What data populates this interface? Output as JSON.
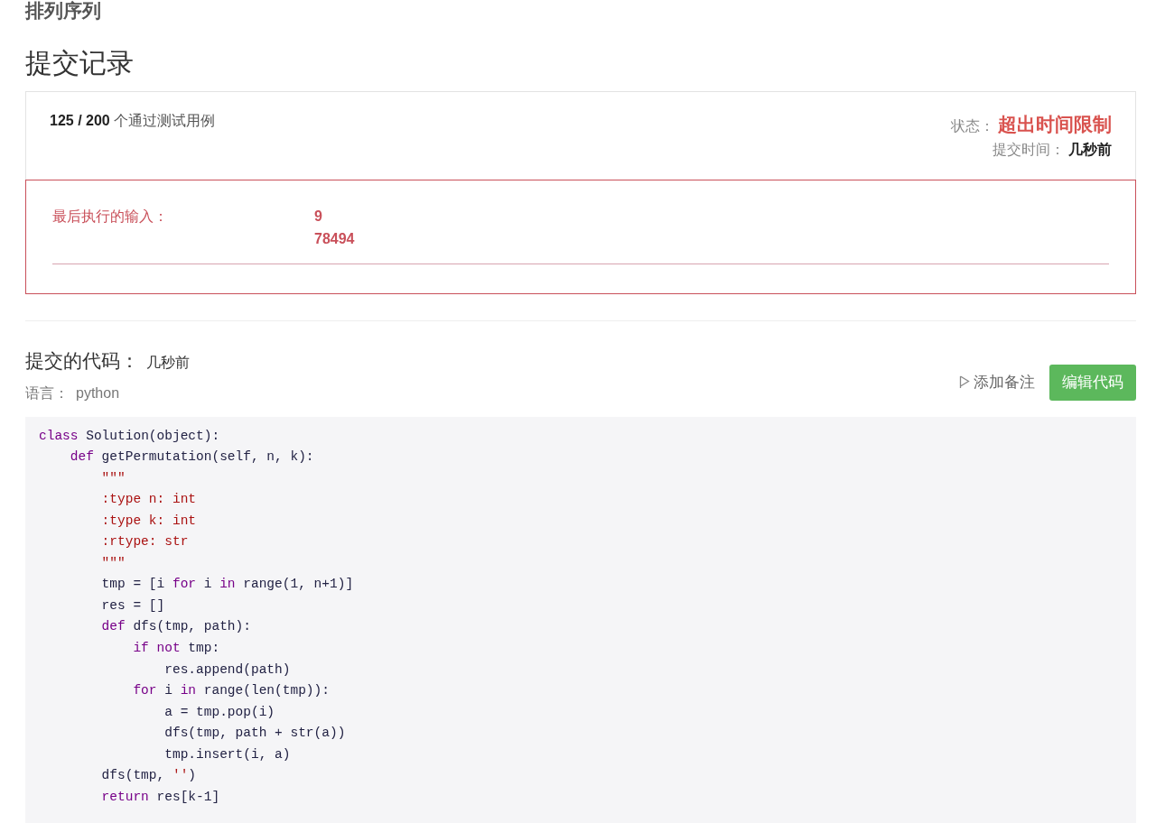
{
  "problem_title": "排列序列",
  "page_title": "提交记录",
  "result": {
    "passed": "125 / 200",
    "passed_label": "个通过测试用例",
    "status_label": "状态：",
    "status": "超出时间限制",
    "time_label": "提交时间：",
    "time": "几秒前"
  },
  "last_input": {
    "label": "最后执行的输入：",
    "lines": [
      "9",
      "78494"
    ]
  },
  "code_section": {
    "title": "提交的代码：",
    "time": "几秒前",
    "language_label": "语言：",
    "language": "python",
    "note_button": "添加备注",
    "edit_button": "编辑代码"
  },
  "code_lines": [
    [
      {
        "text": "class",
        "kind": "keyword"
      },
      {
        "text": " Solution(object):",
        "kind": "plain"
      }
    ],
    [
      {
        "text": "    def",
        "kind": "keyword"
      },
      {
        "text": " getPermutation(self, n, k):",
        "kind": "plain"
      }
    ],
    [
      {
        "text": "        \"\"\"",
        "kind": "string"
      }
    ],
    [
      {
        "text": "        :type n: int",
        "kind": "string"
      }
    ],
    [
      {
        "text": "        :type k: int",
        "kind": "string"
      }
    ],
    [
      {
        "text": "        :rtype: str",
        "kind": "string"
      }
    ],
    [
      {
        "text": "        \"\"\"",
        "kind": "string"
      }
    ],
    [
      {
        "text": "        tmp = [i ",
        "kind": "plain"
      },
      {
        "text": "for",
        "kind": "keyword"
      },
      {
        "text": " i ",
        "kind": "plain"
      },
      {
        "text": "in",
        "kind": "keyword"
      },
      {
        "text": " range(1, n+1)]",
        "kind": "plain"
      }
    ],
    [
      {
        "text": "        res = []",
        "kind": "plain"
      }
    ],
    [
      {
        "text": "        def",
        "kind": "keyword"
      },
      {
        "text": " dfs(tmp, path):",
        "kind": "plain"
      }
    ],
    [
      {
        "text": "            if not",
        "kind": "keyword"
      },
      {
        "text": " tmp:",
        "kind": "plain"
      }
    ],
    [
      {
        "text": "                res.append(path)",
        "kind": "plain"
      }
    ],
    [
      {
        "text": "            for",
        "kind": "keyword"
      },
      {
        "text": " i ",
        "kind": "plain"
      },
      {
        "text": "in",
        "kind": "keyword"
      },
      {
        "text": " range(len(tmp)):",
        "kind": "plain"
      }
    ],
    [
      {
        "text": "                a = tmp.pop(i)",
        "kind": "plain"
      }
    ],
    [
      {
        "text": "                dfs(tmp, path + str(a))",
        "kind": "plain"
      }
    ],
    [
      {
        "text": "                tmp.insert(i, a)",
        "kind": "plain"
      }
    ],
    [
      {
        "text": "        dfs(tmp, ",
        "kind": "plain"
      },
      {
        "text": "''",
        "kind": "string"
      },
      {
        "text": ")",
        "kind": "plain"
      }
    ],
    [
      {
        "text": "        return",
        "kind": "keyword"
      },
      {
        "text": " res[k-1]",
        "kind": "plain"
      }
    ]
  ]
}
